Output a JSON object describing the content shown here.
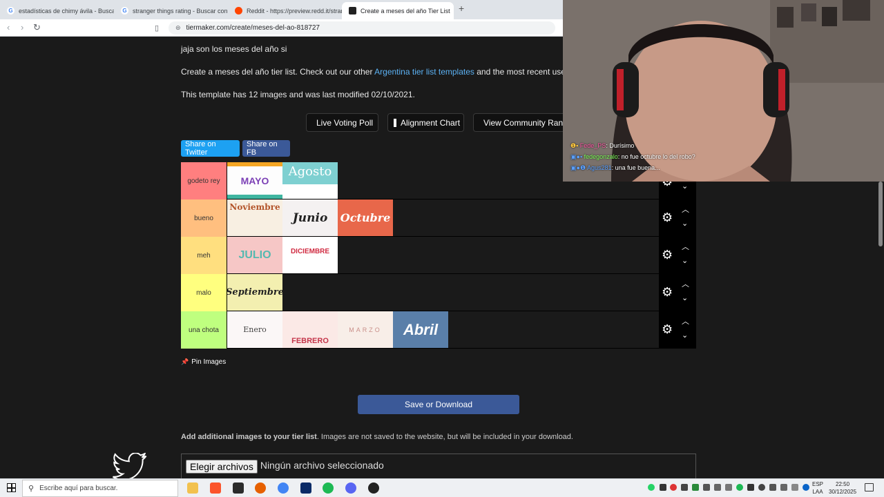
{
  "browser": {
    "tabs": [
      {
        "title": "estadísticas de chimy ávila - Buscar",
        "favicon_color": "#4285f4",
        "active": false
      },
      {
        "title": "stranger things rating - Buscar con G",
        "favicon_color": "#4285f4",
        "active": false
      },
      {
        "title": "Reddit - https://preview.redd.it/stran",
        "favicon_color": "#ff4500",
        "active": false
      },
      {
        "title": "Create a meses del año Tier List",
        "favicon_color": "#222222",
        "active": true
      }
    ],
    "new_tab": "+",
    "url": "tiermaker.com/create/meses-del-ao-818727"
  },
  "page": {
    "intro": "jaja son los meses del año si",
    "description_prefix": "Create a meses del año tier list. Check out our other ",
    "description_link": "Argentina tier list templates",
    "description_suffix": " and the most recent user subi",
    "template_info": "This template has 12 images and was last modified 02/10/2021.",
    "buttons": {
      "live_voting": "Live Voting Poll",
      "alignment_chart": "Alignment Chart",
      "view_community": "View Community Ran"
    },
    "share": {
      "twitter": "Share on Twitter",
      "fb": "Share on FB"
    },
    "tiers": [
      {
        "label": "godeto rey",
        "color": "#ff7f7f",
        "items": [
          {
            "text": "MAYO",
            "bg": "#fdfdfd",
            "fg": "#7b3fb5"
          },
          {
            "text": "Agosto",
            "bg": "#7ed0d1",
            "fg": "#ffffff"
          }
        ]
      },
      {
        "label": "bueno",
        "color": "#ffbf7f",
        "items": [
          {
            "text": "Noviembre",
            "bg": "#f8efe2",
            "fg": "#b3552a"
          },
          {
            "text": "Junio",
            "bg": "#f4f1f1",
            "fg": "#222222"
          },
          {
            "text": "Octubre",
            "bg": "#e8674a",
            "fg": "#ffffff"
          }
        ]
      },
      {
        "label": "meh",
        "color": "#ffdf7f",
        "items": [
          {
            "text": "JULIO",
            "bg": "#f6c7c6",
            "fg": "#55b9b0"
          },
          {
            "text": "DICIEMBRE",
            "bg": "#ffffff",
            "fg": "#d02b41"
          }
        ]
      },
      {
        "label": "malo",
        "color": "#ffff7f",
        "items": [
          {
            "text": "Septiembre",
            "bg": "#f3efb0",
            "fg": "#222222"
          }
        ]
      },
      {
        "label": "una chota",
        "color": "#bfff7f",
        "items": [
          {
            "text": "Enero",
            "bg": "#fbf7f7",
            "fg": "#444444"
          },
          {
            "text": "FEBRERO",
            "bg": "#fbe9e6",
            "fg": "#c4354a"
          },
          {
            "text": "MARZO",
            "bg": "#f8eee8",
            "fg": "#c9908a"
          },
          {
            "text": "Abril",
            "bg": "#5a7fa9",
            "fg": "#ffffff"
          }
        ]
      }
    ],
    "pin_images": "Pin Images",
    "save_button": "Save or Download",
    "add_images_bold": "Add additional images to your tier list",
    "add_images_rest": ". Images are not saved to the website, but will be included in your download.",
    "file_button": "Elegir archivos",
    "file_status": "Ningún archivo seleccionado"
  },
  "chat": [
    {
      "user": "Fede_PS",
      "user_color": "#ff5aa8",
      "msg": ": Durísimo"
    },
    {
      "user": "fedegonzalo",
      "user_color": "#7fff5a",
      "msg": ": no fue octubre lo del robo?"
    },
    {
      "user": "Agus281",
      "user_color": "#5aa0ff",
      "msg": ": una fue buena..."
    }
  ],
  "taskbar": {
    "search_placeholder": "Escribe aquí para buscar.",
    "lang_top": "ESP",
    "lang_bottom": "LAA",
    "time": "22:50",
    "date": "30/12/2025"
  },
  "colors": {
    "page_bg": "#1a1a1a",
    "link": "#5cb2f4",
    "twitter": "#1da1f2",
    "facebook": "#3b5998",
    "save": "#3b5998"
  }
}
